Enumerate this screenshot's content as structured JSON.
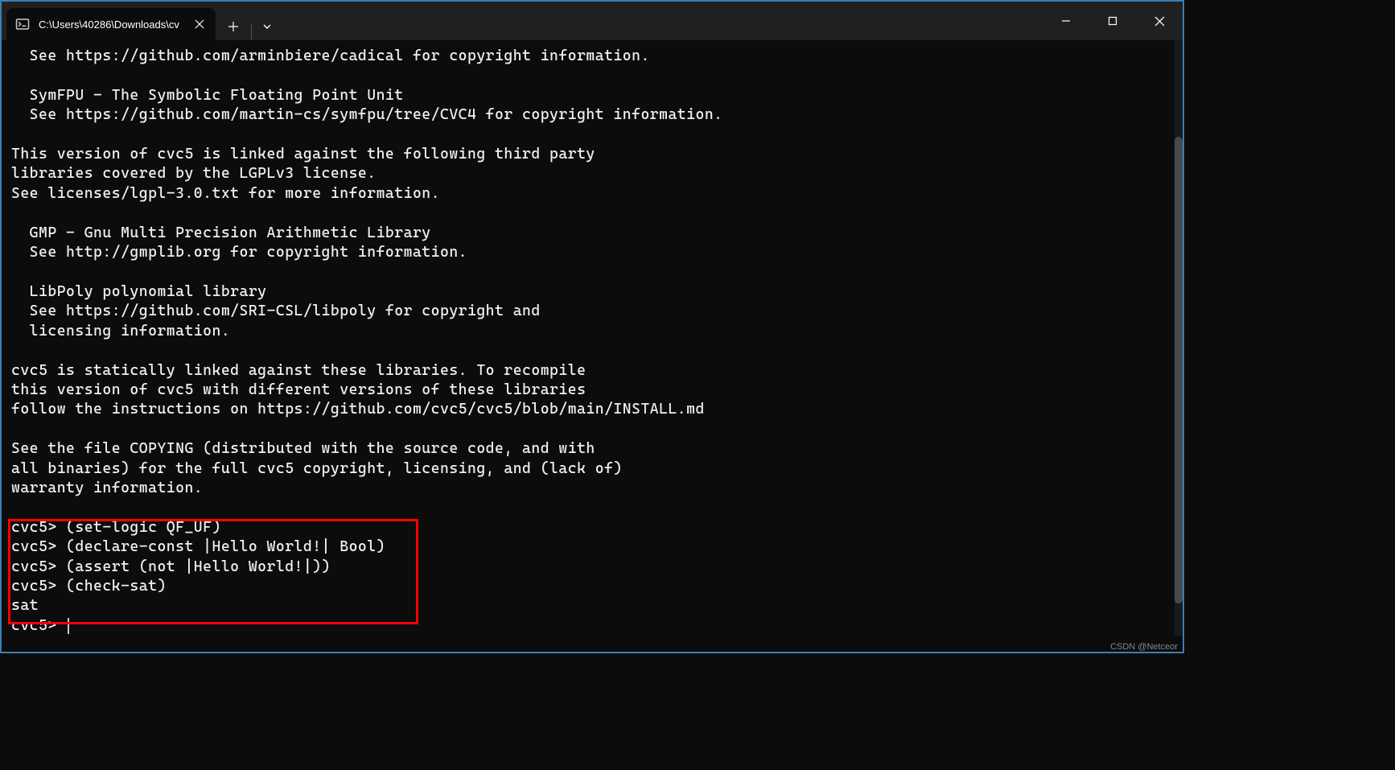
{
  "tab": {
    "title": "C:\\Users\\40286\\Downloads\\cv"
  },
  "terminal": {
    "lines": [
      "  See https://github.com/arminbiere/cadical for copyright information.",
      "",
      "  SymFPU - The Symbolic Floating Point Unit",
      "  See https://github.com/martin-cs/symfpu/tree/CVC4 for copyright information.",
      "",
      "This version of cvc5 is linked against the following third party",
      "libraries covered by the LGPLv3 license.",
      "See licenses/lgpl-3.0.txt for more information.",
      "",
      "  GMP - Gnu Multi Precision Arithmetic Library",
      "  See http://gmplib.org for copyright information.",
      "",
      "  LibPoly polynomial library",
      "  See https://github.com/SRI-CSL/libpoly for copyright and",
      "  licensing information.",
      "",
      "cvc5 is statically linked against these libraries. To recompile",
      "this version of cvc5 with different versions of these libraries",
      "follow the instructions on https://github.com/cvc5/cvc5/blob/main/INSTALL.md",
      "",
      "See the file COPYING (distributed with the source code, and with",
      "all binaries) for the full cvc5 copyright, licensing, and (lack of)",
      "warranty information.",
      "",
      "cvc5> (set-logic QF_UF)",
      "cvc5> (declare-const |Hello World!| Bool)",
      "cvc5> (assert (not |Hello World!|))",
      "cvc5> (check-sat)",
      "sat",
      "cvc5> "
    ]
  },
  "watermark": "CSDN @Netceor"
}
